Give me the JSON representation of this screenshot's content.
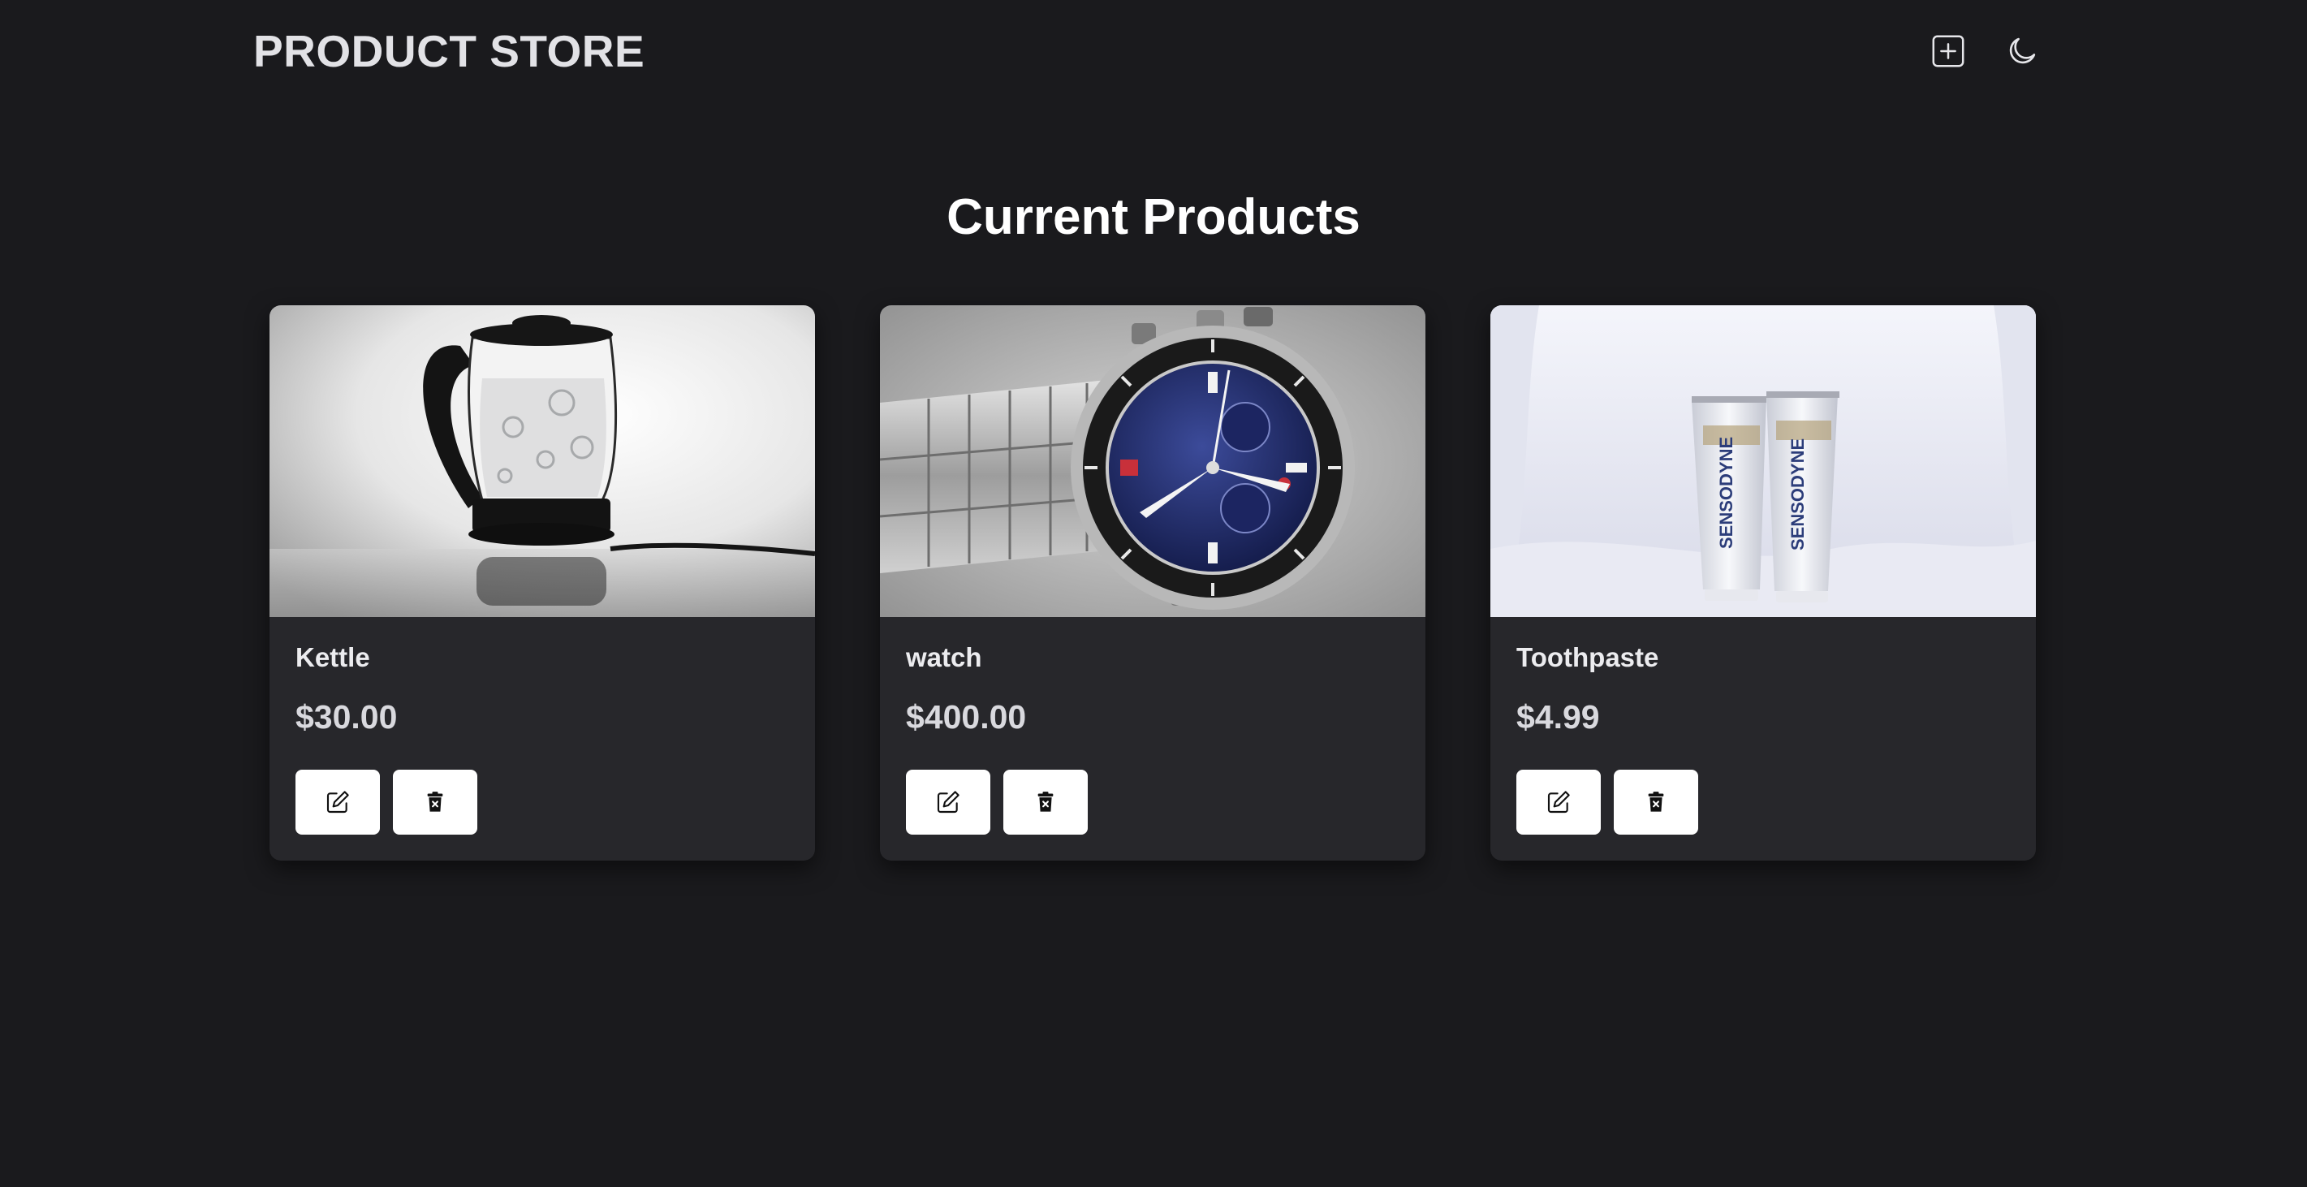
{
  "navbar": {
    "brand": "PRODUCT STORE",
    "add_icon": "plus-square-icon",
    "theme_icon": "moon-icon"
  },
  "main": {
    "heading": "Current Products",
    "products": [
      {
        "name": "Kettle",
        "price": "$30.00",
        "image": "glass-kettle-photo"
      },
      {
        "name": "watch",
        "price": "$400.00",
        "image": "wristwatch-photo"
      },
      {
        "name": "Toothpaste",
        "price": "$4.99",
        "image": "toothpaste-tubes-photo"
      }
    ],
    "actions": {
      "edit_icon": "edit-icon",
      "delete_icon": "trash-icon"
    }
  },
  "colors": {
    "background": "#1a1a1d",
    "card": "#27272b",
    "button": "#ffffff",
    "text": "#e8e8ea"
  }
}
